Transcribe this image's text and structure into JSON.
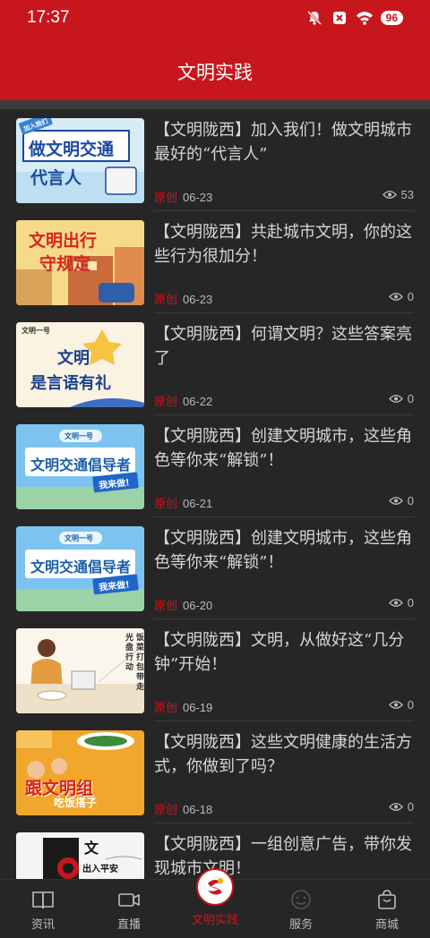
{
  "status_bar": {
    "time": "17:37",
    "battery": "96"
  },
  "header": {
    "title": "文明实践"
  },
  "articles": [
    {
      "title": "【文明陇西】加入我们！做文明城市最好的“代言人”",
      "tag": "原创",
      "date": "06-23",
      "views": "53",
      "thumb_text_1": "做文明交通",
      "thumb_text_2": "代言人",
      "thumb_badge": "加入我们"
    },
    {
      "title": "【文明陇西】共赴城市文明，你的这些行为很加分！",
      "tag": "原创",
      "date": "06-23",
      "views": "0",
      "thumb_text_1": "文明出行",
      "thumb_text_2": "守规定"
    },
    {
      "title": "【文明陇西】何谓文明？这些答案亮了",
      "tag": "原创",
      "date": "06-22",
      "views": "0",
      "thumb_text_1": "文明",
      "thumb_text_2": "是言语有礼",
      "thumb_badge": "文明一号"
    },
    {
      "title": "【文明陇西】创建文明城市，这些角色等你来“解锁”！",
      "tag": "原创",
      "date": "06-21",
      "views": "0",
      "thumb_text_1": "文明交通倡导者",
      "thumb_text_2": "我来做!",
      "thumb_badge": "文明一号"
    },
    {
      "title": "【文明陇西】创建文明城市，这些角色等你来“解锁”！",
      "tag": "原创",
      "date": "06-20",
      "views": "0",
      "thumb_text_1": "文明交通倡导者",
      "thumb_text_2": "我来做!",
      "thumb_badge": "文明一号"
    },
    {
      "title": "【文明陇西】文明，从做好这“几分钟”开始！",
      "tag": "原创",
      "date": "06-19",
      "views": "0",
      "thumb_text_1": "光盘行动",
      "thumb_text_2": "饭菜打包带走"
    },
    {
      "title": "【文明陇西】这些文明健康的生活方式，你做到了吗？",
      "tag": "原创",
      "date": "06-18",
      "views": "0",
      "thumb_text_1": "跟文明组",
      "thumb_text_2": "吃饭搭子"
    },
    {
      "title": "【文明陇西】一组创意广告，带你发现城市文明！",
      "thumb_text_1": "文",
      "thumb_text_2": "出入平安"
    }
  ],
  "bottom_nav": [
    {
      "label": "资讯",
      "icon": "book-icon"
    },
    {
      "label": "直播",
      "icon": "video-camera-icon"
    },
    {
      "label": "文明实践",
      "icon": "civilization-logo-icon",
      "active": true
    },
    {
      "label": "服务",
      "icon": "smile-icon"
    },
    {
      "label": "商城",
      "icon": "shopping-bag-icon"
    }
  ],
  "colors": {
    "brand_red": "#c8161d",
    "background": "#262626",
    "text": "#d6d6d6"
  }
}
